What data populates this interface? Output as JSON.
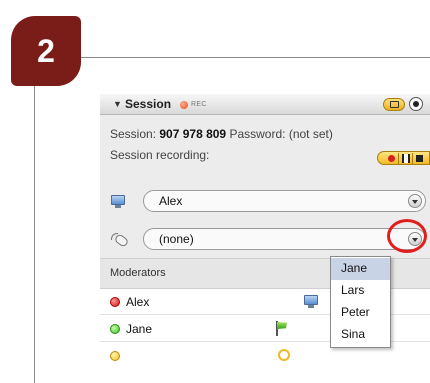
{
  "step": {
    "number": "2"
  },
  "session_panel": {
    "title": "Session",
    "rec_indicator": "REC",
    "session_label": "Session:",
    "session_id": "907 978 809",
    "password_label": "Password:",
    "password_value": "(not set)",
    "recording_label": "Session recording:",
    "presenter_combo": {
      "value": "Alex",
      "icon": "monitor-icon"
    },
    "mouse_control_combo": {
      "value": "(none)",
      "icon": "mouse-icon"
    }
  },
  "moderators": {
    "label": "Moderators",
    "users": [
      {
        "name": "Alex",
        "status": "red",
        "role_icon": "monitor-icon"
      },
      {
        "name": "Jane",
        "status": "green",
        "role_icon": "flag-icon"
      }
    ]
  },
  "dropdown": {
    "options": [
      "Jane",
      "Lars",
      "Peter",
      "Sina"
    ],
    "selected": "Jane"
  },
  "colors": {
    "badge": "#7a1c17",
    "highlight": "#e21d1d",
    "selection": "#c9d3e6"
  }
}
